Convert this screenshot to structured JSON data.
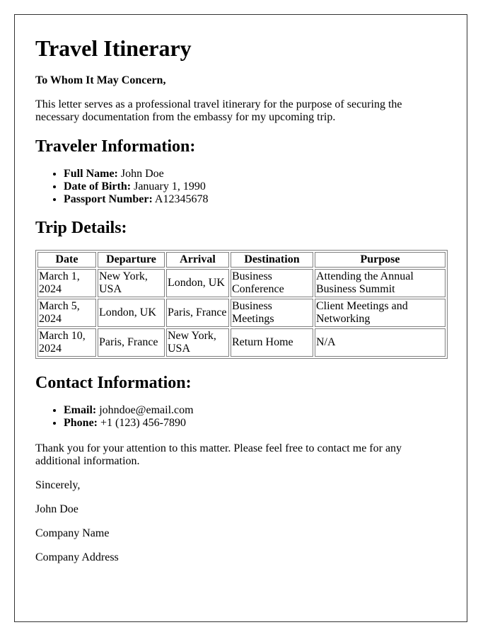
{
  "document": {
    "title": "Travel Itinerary",
    "salutation": "To Whom It May Concern,",
    "intro": "This letter serves as a professional travel itinerary for the purpose of securing the necessary documentation from the embassy for my upcoming trip."
  },
  "traveler": {
    "heading": "Traveler Information:",
    "items": [
      {
        "label": "Full Name:",
        "value": " John Doe"
      },
      {
        "label": "Date of Birth:",
        "value": " January 1, 1990"
      },
      {
        "label": "Passport Number:",
        "value": " A12345678"
      }
    ]
  },
  "trip": {
    "heading": "Trip Details:",
    "columns": [
      "Date",
      "Departure",
      "Arrival",
      "Destination",
      "Purpose"
    ],
    "rows": [
      [
        "March 1, 2024",
        "New York, USA",
        "London, UK",
        "Business Conference",
        "Attending the Annual Business Summit"
      ],
      [
        "March 5, 2024",
        "London, UK",
        "Paris, France",
        "Business Meetings",
        "Client Meetings and Networking"
      ],
      [
        "March 10, 2024",
        "Paris, France",
        "New York, USA",
        "Return Home",
        "N/A"
      ]
    ]
  },
  "contact": {
    "heading": "Contact Information:",
    "items": [
      {
        "label": "Email:",
        "value": " johndoe@email.com"
      },
      {
        "label": "Phone:",
        "value": " +1 (123) 456-7890"
      }
    ]
  },
  "closing": {
    "text": "Thank you for your attention to this matter. Please feel free to contact me for any additional information.",
    "signoff": "Sincerely,",
    "name": "John Doe",
    "company_name": "Company Name",
    "company_address": "Company Address"
  }
}
